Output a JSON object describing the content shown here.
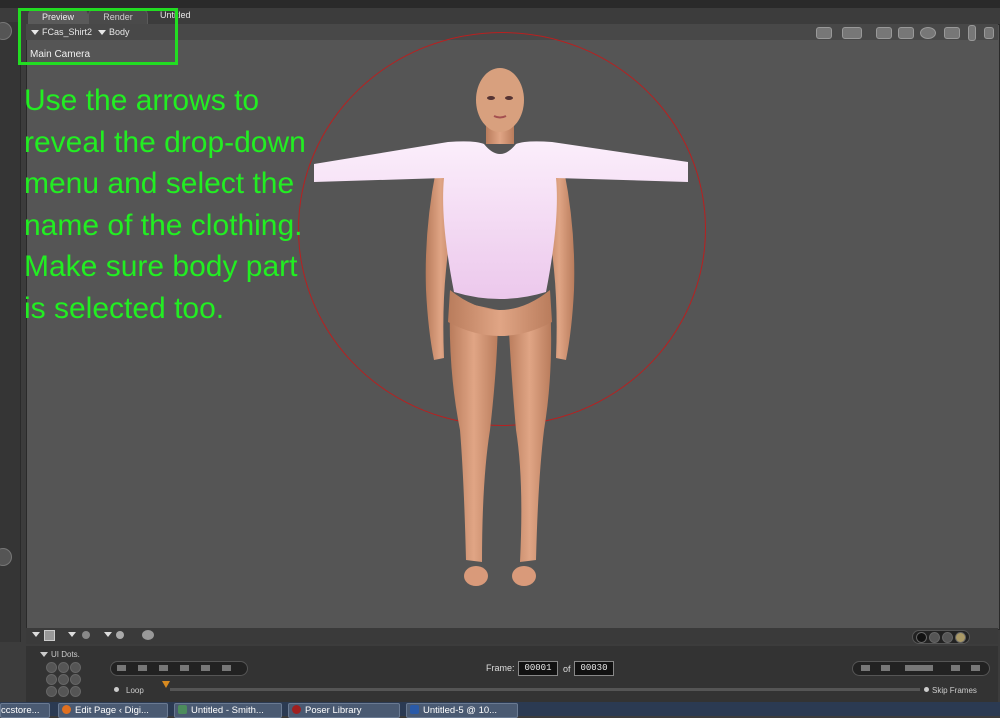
{
  "tabs": [
    {
      "label": "Preview"
    },
    {
      "label": "Render"
    }
  ],
  "document_title": "Untitled",
  "viewport": {
    "figure_dropdown": "FCas_Shirt2",
    "part_dropdown": "Body",
    "camera_label": "Main Camera"
  },
  "instruction": {
    "text": "Use the arrows to reveal the drop-down menu and select the name of the clothing. Make sure body part is selected too."
  },
  "timeline": {
    "ui_dots_label": "UI Dots.",
    "frame_label": "Frame:",
    "current_frame": "00001",
    "of_label": "of",
    "total_frames": "00030",
    "loop_label": "Loop",
    "skip_frames_label": "Skip Frames"
  },
  "taskbar": {
    "items": [
      {
        "label": "ccstore..."
      },
      {
        "label": "Edit Page ‹ Digi..."
      },
      {
        "label": "Untitled - Smith..."
      },
      {
        "label": "Poser Library"
      },
      {
        "label": "Untitled-5 @ 10..."
      }
    ]
  },
  "colors": {
    "accent_green": "#22ee22",
    "orbit_red": "#b82020",
    "shirt": "#f2d8f2"
  }
}
